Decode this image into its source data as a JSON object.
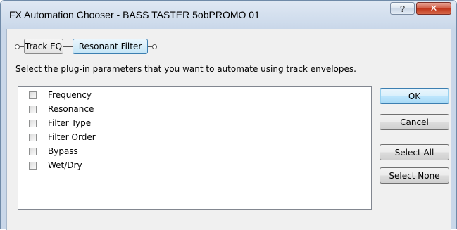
{
  "window": {
    "title": "FX Automation Chooser - BASS TASTER 5obPROMO 01",
    "help_glyph": "?",
    "close_glyph": "✕"
  },
  "fx_chain": {
    "items": [
      {
        "label": "Track EQ",
        "selected": false
      },
      {
        "label": "Resonant Filter",
        "selected": true
      }
    ]
  },
  "instruction": "Select the plug-in parameters that you want to automate using track envelopes.",
  "parameters": [
    {
      "label": "Frequency",
      "checked": false
    },
    {
      "label": "Resonance",
      "checked": false
    },
    {
      "label": "Filter Type",
      "checked": false
    },
    {
      "label": "Filter Order",
      "checked": false
    },
    {
      "label": "Bypass",
      "checked": false
    },
    {
      "label": "Wet/Dry",
      "checked": false
    }
  ],
  "buttons": {
    "ok": "OK",
    "cancel": "Cancel",
    "select_all": "Select All",
    "select_none": "Select None"
  },
  "colors": {
    "accent": "#3c7fb1",
    "close": "#c0361b"
  }
}
